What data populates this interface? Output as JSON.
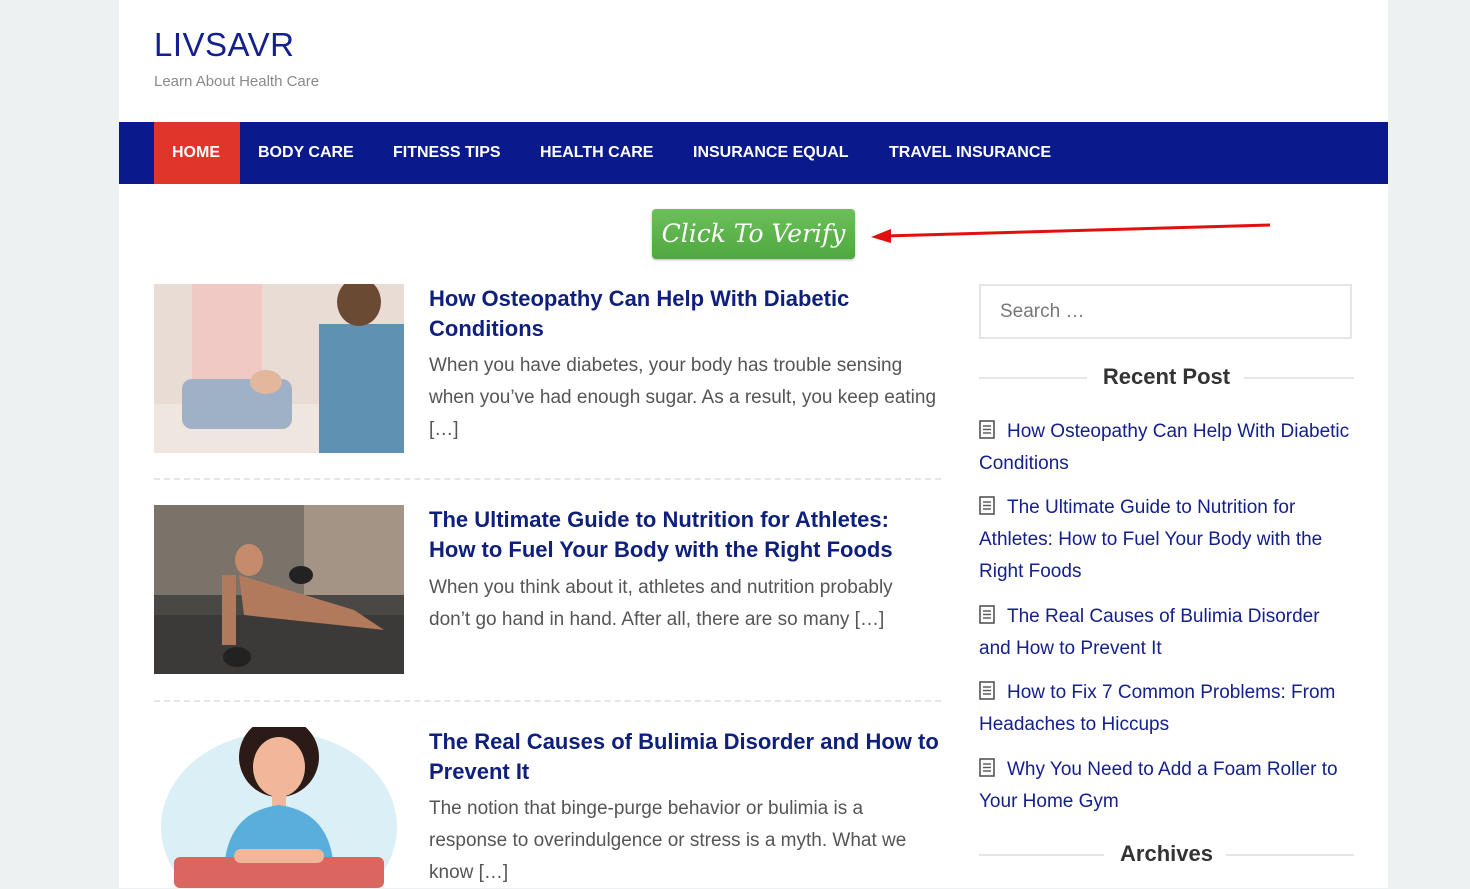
{
  "site": {
    "title": "LIVSAVR",
    "tagline": "Learn About Health Care"
  },
  "nav": {
    "items": [
      {
        "label": "HOME",
        "active": true
      },
      {
        "label": "BODY CARE"
      },
      {
        "label": "FITNESS TIPS"
      },
      {
        "label": "HEALTH CARE"
      },
      {
        "label": "INSURANCE EQUAL"
      },
      {
        "label": "TRAVEL INSURANCE"
      }
    ]
  },
  "verify_button": {
    "label": "Click To Verify"
  },
  "posts": [
    {
      "title": "How Osteopathy Can Help With Diabetic Conditions",
      "excerpt": "When you have diabetes, your body has trouble sensing when you’ve had enough sugar. As a result, you keep eating […]"
    },
    {
      "title": "The Ultimate Guide to Nutrition for Athletes: How to Fuel Your Body with the Right Foods",
      "excerpt": "When you think about it, athletes and nutrition probably don’t go hand in hand. After all, there are so many […]"
    },
    {
      "title": "The Real Causes of Bulimia Disorder and How to Prevent It",
      "excerpt": "The notion that binge-purge behavior or bulimia is a response to overindulgence or stress is a myth. What we know […]"
    }
  ],
  "sidebar": {
    "search_placeholder": "Search …",
    "recent_title": "Recent Post",
    "recent": [
      "How Osteopathy Can Help With Diabetic Conditions",
      "The Ultimate Guide to Nutrition for Athletes: How to Fuel Your Body with the Right Foods",
      "The Real Causes of Bulimia Disorder and How to Prevent It",
      "How to Fix 7 Common Problems: From Headaches to Hiccups",
      "Why You Need to Add a Foam Roller to Your Home Gym"
    ],
    "archives_title": "Archives"
  },
  "colors": {
    "nav_bg": "#0a1a8c",
    "nav_active": "#e0352b",
    "title_color": "#14208c",
    "verify_green": "#5cb94b",
    "arrow_red": "#e01010"
  }
}
